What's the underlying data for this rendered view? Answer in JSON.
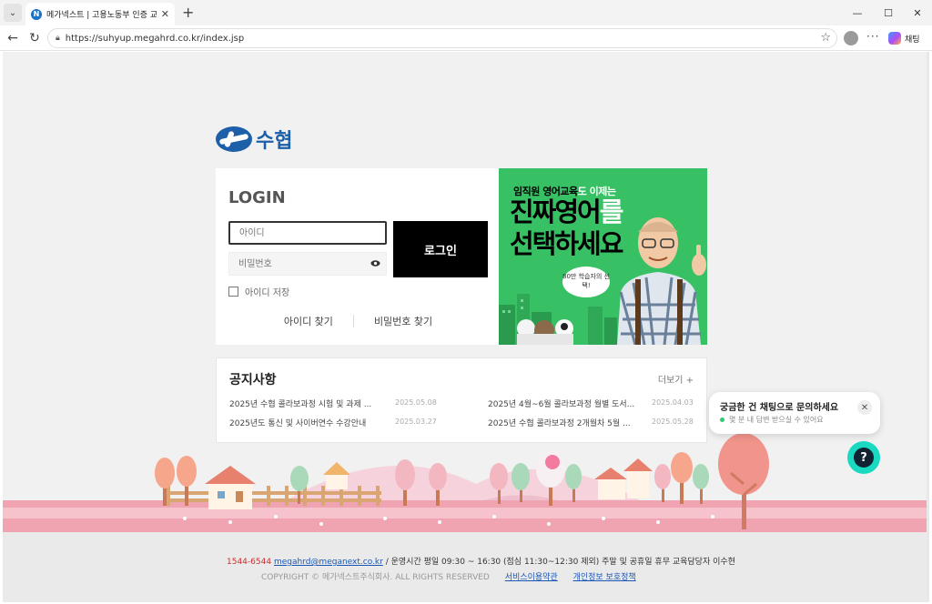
{
  "browser": {
    "tab_title": "메가넥스트 | 고용노동부 인증 교육",
    "favicon_text": "N",
    "url": "https://suhyup.megahrd.co.kr/index.jsp",
    "chat_label": "채팅",
    "icons": [
      "tab-menu-icon",
      "close-icon",
      "plus-icon",
      "minimize-icon",
      "maximize-icon",
      "close-window-icon",
      "back-icon",
      "refresh-icon",
      "lock-icon",
      "star-icon",
      "profile-icon",
      "more-icon",
      "copilot-icon"
    ]
  },
  "brand": {
    "logo_text": "수협",
    "color": "#1d5fa8"
  },
  "login": {
    "title": "LOGIN",
    "id_placeholder": "아이디",
    "pw_placeholder": "비밀번호",
    "button": "로그인",
    "remember": "아이디 저장",
    "find_id": "아이디 찾기",
    "find_pw": "비밀번호 찾기"
  },
  "banner": {
    "top_black": "임직원 영어교육",
    "top_white": "도 이제는",
    "line1_black": "진짜영어",
    "line1_white": "를",
    "line2": "선택하세요",
    "bubble": "80만 학습자의 선택!",
    "color": "#38c064"
  },
  "notice": {
    "title": "공지사항",
    "more": "더보기 +",
    "items": [
      {
        "title": "2025년 수협 콜라보과정 시험 및 과제 ...",
        "date": "2025.05.08"
      },
      {
        "title": "2025년 4월~6월 콜라보과정 월별 도서...",
        "date": "2025.04.03"
      },
      {
        "title": "2025년도 통신 및 사이버연수 수강안내",
        "date": "2025.03.27"
      },
      {
        "title": "2025년 수협 콜라보과정 2개월차 5월 ...",
        "date": "2025.05.28"
      }
    ]
  },
  "footer": {
    "tel": "1544-6544",
    "email": "megahrd@meganext.co.kr",
    "hours": "/ 운영시간 평일 09:30 ~ 16:30 (점심 11:30~12:30 제외) 주말 및 공휴일 휴무 교육담당자 이수현",
    "copyright": "COPYRIGHT © 메가넥스트주식회사. ALL RIGHTS RESERVED",
    "terms": "서비스이용약관",
    "privacy": "개인정보 보호정책"
  },
  "chat": {
    "title": "궁금한 건 채팅으로 문의하세요",
    "subtitle": "몇 분 내 답변 받으실 수 있어요",
    "fab_icon": "?",
    "accent": "#19d9c0"
  }
}
